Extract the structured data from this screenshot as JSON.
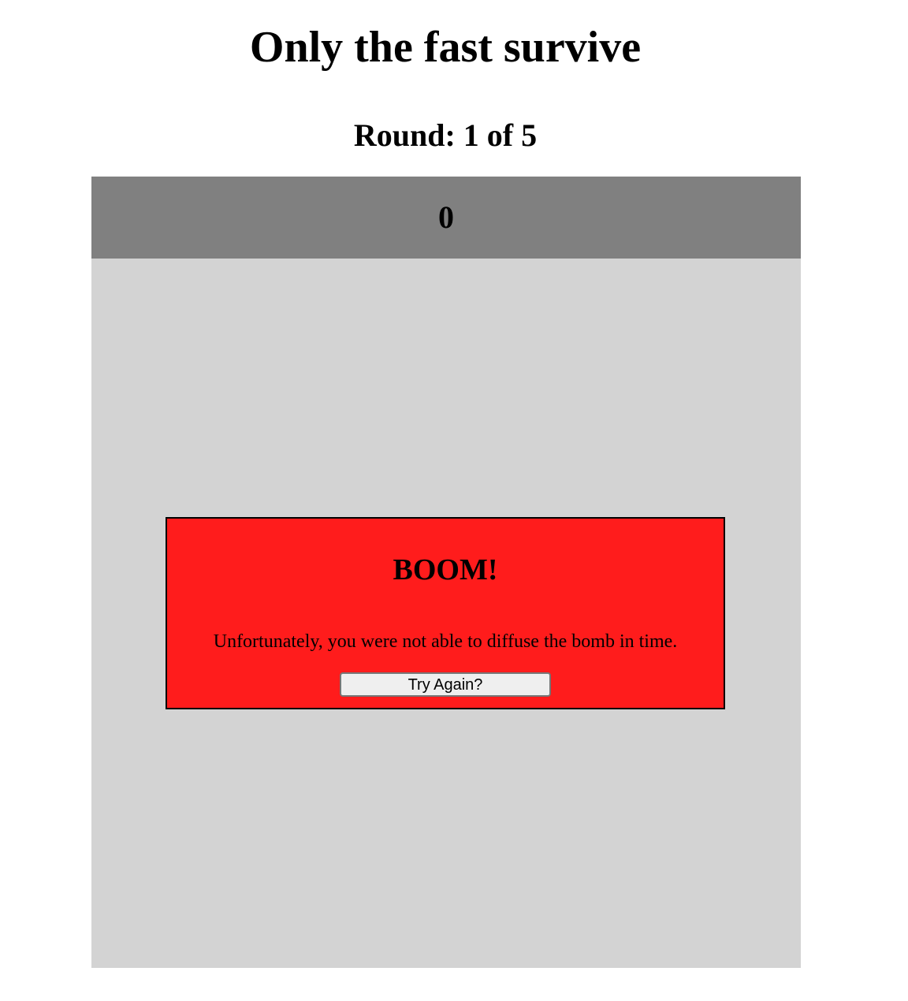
{
  "header": {
    "title": "Only the fast survive",
    "round_text": "Round: 1 of 5"
  },
  "game": {
    "timer_value": "0",
    "dialog": {
      "title": "BOOM!",
      "message": "Unfortunately, you were not able to diffuse the bomb in time.",
      "button_label": "Try Again?"
    }
  },
  "colors": {
    "timer_bar": "#808080",
    "game_area": "#d3d3d3",
    "dialog_background": "#ff1c1c",
    "button_background": "#efefef"
  }
}
